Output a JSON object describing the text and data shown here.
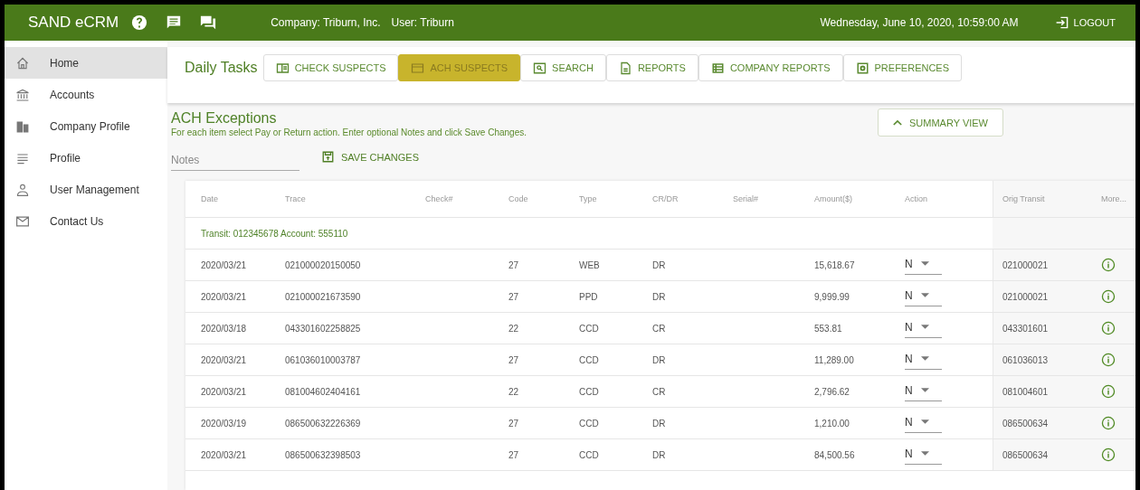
{
  "header": {
    "brand": "SAND eCRM",
    "company": "Company: Triburn, Inc.",
    "user": "User: Triburn",
    "datetime": "Wednesday, June 10, 2020, 10:59:00 AM",
    "logout": "LOGOUT"
  },
  "sidebar": {
    "items": [
      {
        "label": "Home",
        "kind": "home",
        "selected": true
      },
      {
        "label": "Accounts",
        "kind": "bank",
        "selected": false
      },
      {
        "label": "Company Profile",
        "kind": "building",
        "selected": false
      },
      {
        "label": "Profile",
        "kind": "lines",
        "selected": false
      },
      {
        "label": "User Management",
        "kind": "person",
        "selected": false
      },
      {
        "label": "Contact Us",
        "kind": "mail",
        "selected": false
      }
    ]
  },
  "tasks": {
    "title": "Daily Tasks",
    "tabs": [
      {
        "label": "CHECK SUSPECTS",
        "kind": "check",
        "selected": false
      },
      {
        "label": "ACH SUSPECTS",
        "kind": "card",
        "selected": true
      },
      {
        "label": "SEARCH",
        "kind": "search",
        "selected": false
      },
      {
        "label": "REPORTS",
        "kind": "doc",
        "selected": false
      },
      {
        "label": "COMPANY REPORTS",
        "kind": "list",
        "selected": false
      },
      {
        "label": "PREFERENCES",
        "kind": "gear",
        "selected": false
      }
    ]
  },
  "section": {
    "title": "ACH Exceptions",
    "instructions": "For each item select Pay or Return action. Enter optional Notes and click Save Changes.",
    "notes": {
      "placeholder": "Notes"
    },
    "save": "SAVE CHANGES",
    "summary": "SUMMARY VIEW"
  },
  "table": {
    "columns": [
      "Date",
      "Trace",
      "Check#",
      "Code",
      "Type",
      "CR/DR",
      "Serial#",
      "Amount($)",
      "Action",
      "Orig Transit",
      "More..."
    ],
    "group": "Transit: 012345678 Account: 555110",
    "rows": [
      {
        "date": "2020/03/21",
        "trace": "021000020150050",
        "code": "27",
        "type": "WEB",
        "crdr": "DR",
        "amount": "15,618.67",
        "action": "N",
        "orig_transit": "021000021"
      },
      {
        "date": "2020/03/21",
        "trace": "021000021673590",
        "code": "27",
        "type": "PPD",
        "crdr": "DR",
        "amount": "9,999.99",
        "action": "N",
        "orig_transit": "021000021"
      },
      {
        "date": "2020/03/18",
        "trace": "043301602258825",
        "code": "22",
        "type": "CCD",
        "crdr": "CR",
        "amount": "553.81",
        "action": "N",
        "orig_transit": "043301601"
      },
      {
        "date": "2020/03/21",
        "trace": "061036010003787",
        "code": "27",
        "type": "CCD",
        "crdr": "DR",
        "amount": "11,289.00",
        "action": "N",
        "orig_transit": "061036013"
      },
      {
        "date": "2020/03/21",
        "trace": "081004602404161",
        "code": "22",
        "type": "CCD",
        "crdr": "CR",
        "amount": "2,796.62",
        "action": "N",
        "orig_transit": "081004601"
      },
      {
        "date": "2020/03/19",
        "trace": "086500632226369",
        "code": "27",
        "type": "CCD",
        "crdr": "DR",
        "amount": "1,210.00",
        "action": "N",
        "orig_transit": "086500634"
      },
      {
        "date": "2020/03/21",
        "trace": "086500632398503",
        "code": "27",
        "type": "CCD",
        "crdr": "DR",
        "amount": "84,500.56",
        "action": "N",
        "orig_transit": "086500634"
      }
    ]
  }
}
